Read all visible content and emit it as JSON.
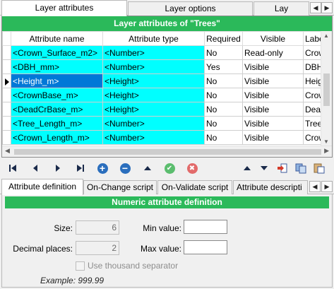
{
  "top_tabs": [
    {
      "label": "Layer attributes",
      "active": true
    },
    {
      "label": "Layer options",
      "active": false
    },
    {
      "label": "Lay",
      "active": false
    }
  ],
  "grid": {
    "title": "Layer attributes of \"Trees\"",
    "columns": [
      "Attribute name",
      "Attribute type",
      "Required",
      "Visible",
      "Labe"
    ],
    "rows": [
      {
        "name": "<Crown_Surface_m2>",
        "type": "<Number>",
        "required": "No",
        "visible": "Read-only",
        "label": "Crow",
        "selected": false
      },
      {
        "name": "<DBH_mm>",
        "type": "<Number>",
        "required": "Yes",
        "visible": "Visible",
        "label": "DBH",
        "selected": false
      },
      {
        "name": "<Height_m>",
        "type": "<Height>",
        "required": "No",
        "visible": "Visible",
        "label": "Heig",
        "selected": true
      },
      {
        "name": "<CrownBase_m>",
        "type": "<Height>",
        "required": "No",
        "visible": "Visible",
        "label": "Crow",
        "selected": false
      },
      {
        "name": "<DeadCrBase_m>",
        "type": "<Height>",
        "required": "No",
        "visible": "Visible",
        "label": "Dead",
        "selected": false
      },
      {
        "name": "<Tree_Length_m>",
        "type": "<Number>",
        "required": "No",
        "visible": "Visible",
        "label": "Tree",
        "selected": false
      },
      {
        "name": "<Crown_Length_m>",
        "type": "<Number>",
        "required": "No",
        "visible": "Visible",
        "label": "Crow",
        "selected": false
      }
    ]
  },
  "toolbar": {
    "icons": [
      "first-record-icon",
      "prev-record-icon",
      "next-record-icon",
      "last-record-icon",
      "add-icon",
      "remove-icon",
      "up-icon",
      "confirm-icon",
      "cancel-icon",
      "move-up-icon",
      "move-down-icon",
      "import-icon",
      "copy-icon",
      "paste-icon"
    ]
  },
  "lower_tabs": [
    {
      "label": "Attribute definition",
      "active": true
    },
    {
      "label": "On-Change script",
      "active": false
    },
    {
      "label": "On-Validate script",
      "active": false
    },
    {
      "label": "Attribute descripti",
      "active": false
    }
  ],
  "panel": {
    "title": "Numeric attribute definition",
    "size_label": "Size:",
    "size_value": "6",
    "decimal_label": "Decimal places:",
    "decimal_value": "2",
    "min_label": "Min value:",
    "min_value": "",
    "max_label": "Max value:",
    "max_value": "",
    "thousand_label": "Use thousand separator",
    "thousand_checked": false,
    "example": "Example: 999.99"
  },
  "colors": {
    "header_green": "#2bb95a",
    "cell_cyan": "#00ffff",
    "selection_blue": "#0078d7",
    "add_blue": "#2a6ebd",
    "confirm_green": "#5bbd6e",
    "cancel_red": "#e26a6a"
  }
}
